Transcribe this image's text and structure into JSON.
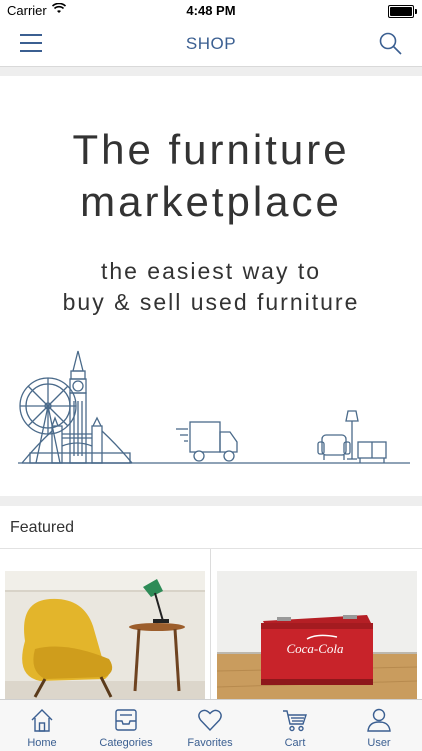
{
  "status_bar": {
    "carrier": "Carrier",
    "time": "4:48 PM"
  },
  "nav": {
    "title": "SHOP"
  },
  "hero": {
    "title_line1": "The furniture",
    "title_line2": "marketplace",
    "subtitle_line1": "the easiest way to",
    "subtitle_line2": "buy & sell used furniture"
  },
  "featured": {
    "heading": "Featured"
  },
  "tabs": [
    {
      "label": "Home",
      "icon": "home-icon"
    },
    {
      "label": "Categories",
      "icon": "tray-icon"
    },
    {
      "label": "Favorites",
      "icon": "heart-icon"
    },
    {
      "label": "Cart",
      "icon": "cart-icon"
    },
    {
      "label": "User",
      "icon": "user-icon"
    }
  ],
  "colors": {
    "accent": "#3b5f91",
    "line_art": "#4a6a8a",
    "chair_yellow": "#e3b52b",
    "cooler_red": "#c8232a"
  }
}
